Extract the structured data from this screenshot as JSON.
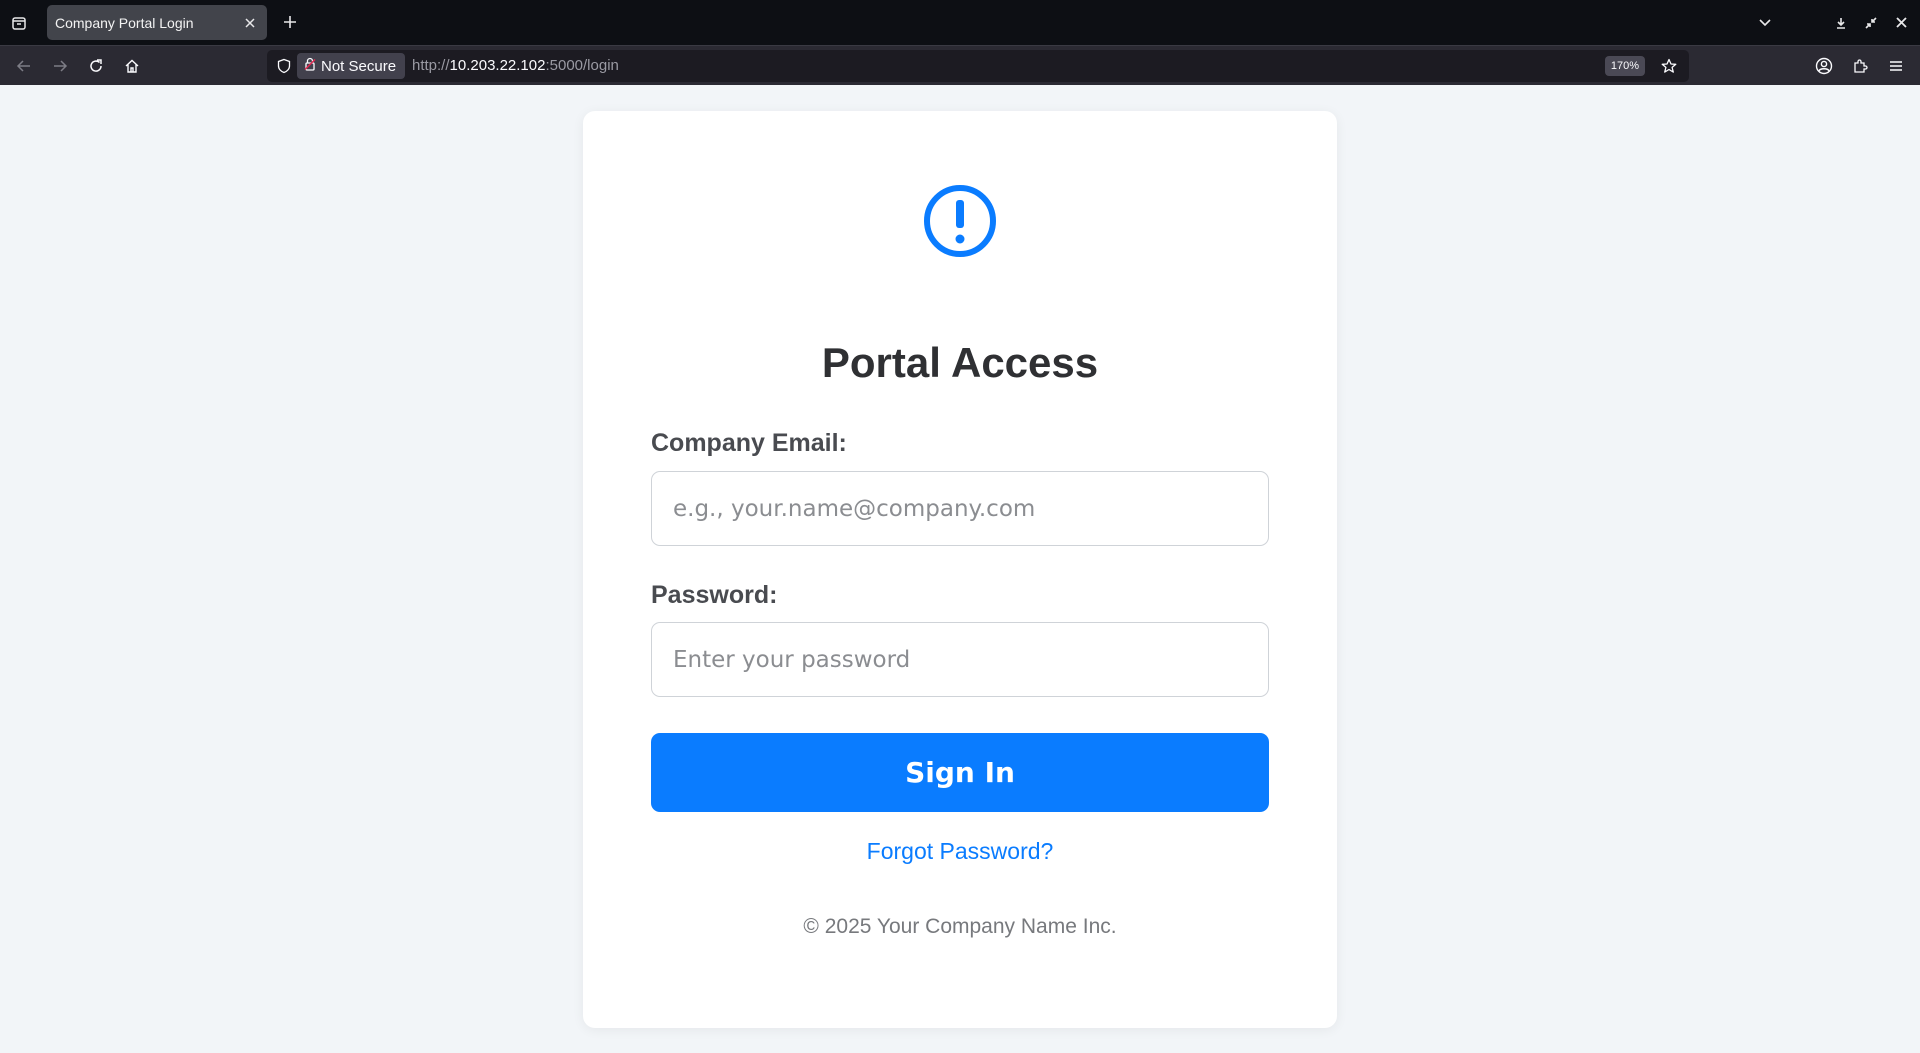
{
  "browser": {
    "tab": {
      "title": "Company Portal Login"
    },
    "address_bar": {
      "security_label": "Not Secure",
      "url_scheme": "http://",
      "url_host": "10.203.22.102",
      "url_rest": ":5000/login",
      "zoom": "170%"
    },
    "icons": {
      "tab_list": "tab-list-icon",
      "close_tab": "close-icon",
      "new_tab": "plus-icon",
      "list_all_tabs": "chevron-down-icon",
      "back": "back-arrow-icon",
      "forward": "forward-arrow-icon",
      "reload": "reload-icon",
      "home": "home-icon",
      "shield": "shield-icon",
      "insecure_lock": "lock-icon",
      "bookmark": "star-icon",
      "account": "account-icon",
      "extensions": "extensions-icon",
      "menu": "hamburger-menu-icon"
    }
  },
  "login": {
    "icon": "alert-circle-icon",
    "title": "Portal Access",
    "email": {
      "label": "Company Email:",
      "value": "",
      "placeholder": "e.g., your.name@company.com"
    },
    "password": {
      "label": "Password:",
      "value": "",
      "placeholder": "Enter your password"
    },
    "submit_label": "Sign In",
    "forgot_label": "Forgot Password?",
    "copyright": "© 2025 Your Company Name Inc."
  },
  "colors": {
    "accent": "#0a7cff",
    "page_background": "#f2f5f8",
    "card_background": "#ffffff",
    "chrome_dark": "#0d0f14"
  }
}
